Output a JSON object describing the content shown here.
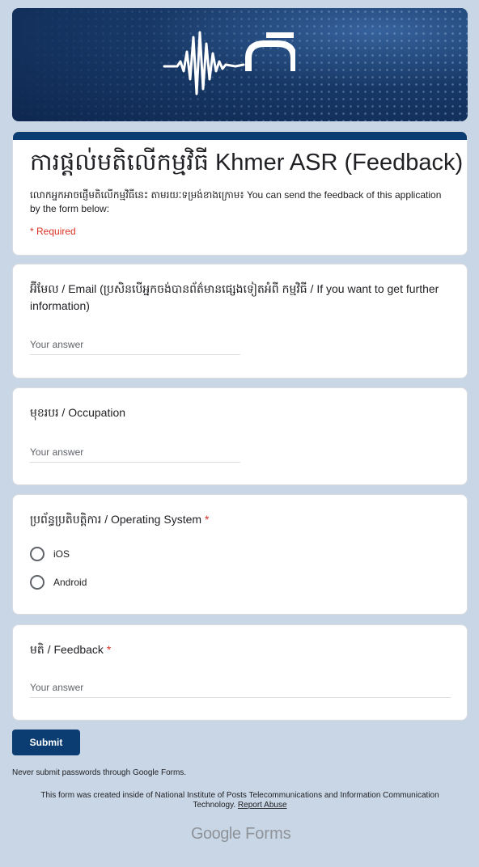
{
  "form": {
    "title": "ការផ្តល់មតិលើកម្មវិធី Khmer ASR (Feedback)",
    "description": "លោកអ្នកអាចផ្ញើមតិលើកម្មវិធីនេះ តាមរយៈទម្រង់ខាងក្រោម៖ You can send the feedback of this application by the form below:",
    "required_note": "* Required"
  },
  "questions": [
    {
      "title": "អ៊ីមែល / Email (ប្រសិនបើអ្នកចង់បានព័ត៌មានផ្សេងទៀតអំពី កម្មវិធី / If you want to get further information)",
      "required": false,
      "placeholder": "Your answer"
    },
    {
      "title": "មុខរបរ / Occupation",
      "required": false,
      "placeholder": "Your answer"
    },
    {
      "title": "ប្រព័ន្ធប្រតិបត្តិការ / Operating System",
      "required": true,
      "options": [
        "iOS",
        "Android"
      ]
    },
    {
      "title": "មតិ / Feedback",
      "required": true,
      "placeholder": "Your answer"
    }
  ],
  "required_star": "*",
  "submit_label": "Submit",
  "footer": {
    "never_submit": "Never submit passwords through Google Forms.",
    "created_by": "This form was created inside of National Institute of Posts Telecommunications and Information Communication Technology.",
    "report_abuse": "Report Abuse",
    "brand_google": "Google",
    "brand_forms": "Forms"
  },
  "colors": {
    "accent": "#0b3d73",
    "background": "#c9d6e6",
    "required": "#d93025"
  },
  "icons": {
    "banner_logo": "sound-wave-logo-icon",
    "radio": "radio-unchecked-icon"
  }
}
